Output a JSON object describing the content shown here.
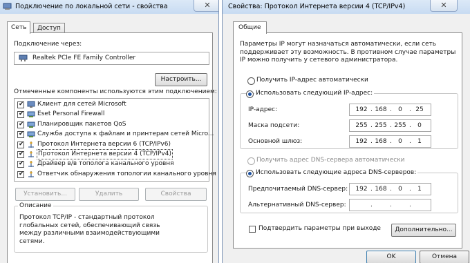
{
  "left_window": {
    "title": "Подключение по локальной сети - свойства",
    "tabs": [
      "Сеть",
      "Доступ"
    ],
    "connect_via_label": "Подключение через:",
    "adapter_name": "Realtek PCIe FE Family Controller",
    "configure_button": "Настроить...",
    "components_label": "Отмеченные компоненты используются этим подключением:",
    "components": [
      {
        "label": "Клиент для сетей Microsoft",
        "checked": true,
        "icon": "network-client-icon",
        "selected": false
      },
      {
        "label": "Eset Personal Firewall",
        "checked": true,
        "icon": "network-service-icon",
        "selected": false
      },
      {
        "label": "Планировщик пакетов QoS",
        "checked": true,
        "icon": "network-service-icon",
        "selected": false
      },
      {
        "label": "Служба доступа к файлам и принтерам сетей Micro...",
        "checked": true,
        "icon": "network-service-icon",
        "selected": false
      },
      {
        "label": "Протокол Интернета версии 6 (TCP/IPv6)",
        "checked": true,
        "icon": "protocol-icon",
        "selected": false
      },
      {
        "label": "Протокол Интернета версии 4 (TCP/IPv4)",
        "checked": true,
        "icon": "protocol-icon",
        "selected": true
      },
      {
        "label": "Драйвер в/в тополога канального уровня",
        "checked": true,
        "icon": "protocol-icon",
        "selected": false
      },
      {
        "label": "Ответчик обнаружения топологии канального уровня",
        "checked": true,
        "icon": "protocol-icon",
        "selected": false
      }
    ],
    "install_button": "Установить...",
    "remove_button": "Удалить",
    "properties_button": "Свойства",
    "description_title": "Описание",
    "description_text": "Протокол TCP/IP - стандартный протокол глобальных сетей, обеспечивающий связь между различными взаимодействующими сетями."
  },
  "right_window": {
    "title": "Свойства: Протокол Интернета версии 4 (TCP/IPv4)",
    "tab": "Общие",
    "info_text": [
      "Параметры IP могут назначаться автоматически, если сеть",
      "поддерживает эту возможность. В противном случае параметры",
      "IP можно получить у сетевого администратора."
    ],
    "radio_auto_ip": "Получить IP-адрес автоматически",
    "radio_manual_ip": "Использовать следующий IP-адрес:",
    "ip_label": "IP-адрес:",
    "ip_value": [
      "192",
      "168",
      "0",
      "25"
    ],
    "mask_label": "Маска подсети:",
    "mask_value": [
      "255",
      "255",
      "255",
      "0"
    ],
    "gateway_label": "Основной шлюз:",
    "gateway_value": [
      "192",
      "168",
      "0",
      "1"
    ],
    "radio_auto_dns": "Получить адрес DNS-сервера автоматически",
    "radio_manual_dns": "Использовать следующие адреса DNS-серверов:",
    "preferred_dns_label": "Предпочитаемый DNS-сервер:",
    "preferred_dns_value": [
      "192",
      "168",
      "0",
      "1"
    ],
    "alternate_dns_label": "Альтернативный DNS-сервер:",
    "alternate_dns_value": [
      "",
      "",
      "",
      ""
    ],
    "validate_checkbox": "Подтвердить параметры при выходе",
    "advanced_button": "Дополнительно...",
    "ok_button": "OK",
    "cancel_button": "Отмена"
  },
  "colors": {
    "titlebar": "#c7dbf2",
    "selection": "#3399ff",
    "dialog_bg": "#f0f0f0"
  }
}
